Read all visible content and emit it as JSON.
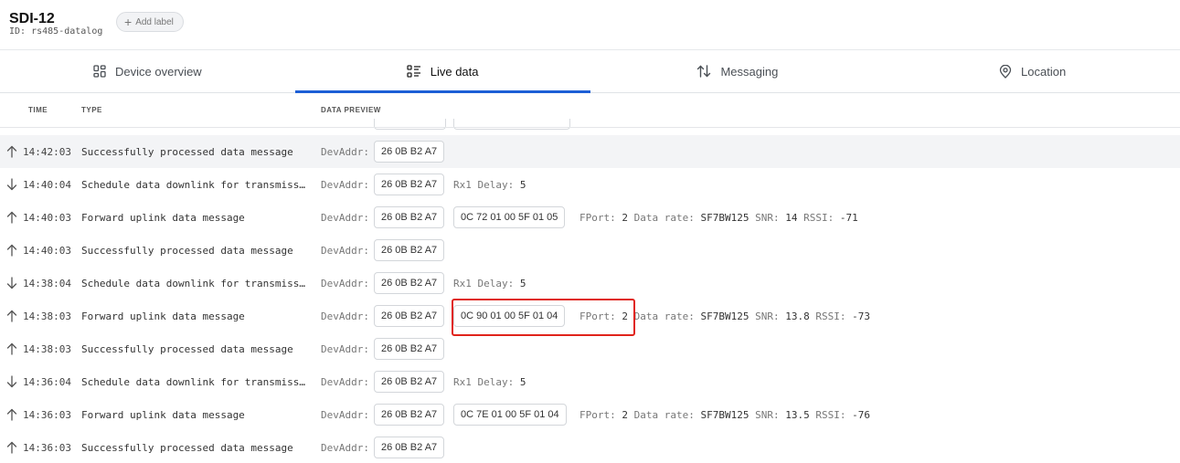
{
  "device": {
    "title": "SDI-12",
    "id_label": "ID:",
    "id_value": "rs485-datalog",
    "add_label": "Add label"
  },
  "tabs": [
    {
      "label": "Device overview",
      "icon": "grid-icon",
      "active": false
    },
    {
      "label": "Live data",
      "icon": "list-icon",
      "active": true
    },
    {
      "label": "Messaging",
      "icon": "arrows-updown-icon",
      "active": false
    },
    {
      "label": "Location",
      "icon": "pin-icon",
      "active": false
    }
  ],
  "columns": {
    "time": "TIME",
    "type": "TYPE",
    "preview": "DATA PREVIEW"
  },
  "rows": [
    {
      "dir": "up",
      "time": "14:42:03",
      "type": "Successfully processed data message",
      "label": "DevAddr:",
      "addr": "26 0B B2 A7",
      "payload": "",
      "extras": []
    },
    {
      "dir": "down",
      "time": "14:40:04",
      "type": "Schedule data downlink for transmission",
      "label": "DevAddr:",
      "addr": "26 0B B2 A7",
      "payload": "",
      "rx1_label": "Rx1 Delay:",
      "rx1_value": "5"
    },
    {
      "dir": "up",
      "time": "14:40:03",
      "type": "Forward uplink data message",
      "label": "DevAddr:",
      "addr": "26 0B B2 A7",
      "payload": "0C 72 01 00 5F 01 05",
      "fport_label": "FPort:",
      "fport": "2",
      "rate_label": "Data rate:",
      "rate": "SF7BW125",
      "snr_label": "SNR:",
      "snr": "14",
      "rssi_label": "RSSI:",
      "rssi": "-71"
    },
    {
      "dir": "up",
      "time": "14:40:03",
      "type": "Successfully processed data message",
      "label": "DevAddr:",
      "addr": "26 0B B2 A7",
      "payload": ""
    },
    {
      "dir": "down",
      "time": "14:38:04",
      "type": "Schedule data downlink for transmission",
      "label": "DevAddr:",
      "addr": "26 0B B2 A7",
      "payload": "",
      "rx1_label": "Rx1 Delay:",
      "rx1_value": "5"
    },
    {
      "dir": "up",
      "time": "14:38:03",
      "type": "Forward uplink data message",
      "label": "DevAddr:",
      "addr": "26 0B B2 A7",
      "payload": "0C 90 01 00 5F 01 04",
      "fport_label": "FPort:",
      "fport": "2",
      "rate_label": "Data rate:",
      "rate": "SF7BW125",
      "snr_label": "SNR:",
      "snr": "13.8",
      "rssi_label": "RSSI:",
      "rssi": "-73"
    },
    {
      "dir": "up",
      "time": "14:38:03",
      "type": "Successfully processed data message",
      "label": "DevAddr:",
      "addr": "26 0B B2 A7",
      "payload": ""
    },
    {
      "dir": "down",
      "time": "14:36:04",
      "type": "Schedule data downlink for transmission",
      "label": "DevAddr:",
      "addr": "26 0B B2 A7",
      "payload": "",
      "rx1_label": "Rx1 Delay:",
      "rx1_value": "5"
    },
    {
      "dir": "up",
      "time": "14:36:03",
      "type": "Forward uplink data message",
      "label": "DevAddr:",
      "addr": "26 0B B2 A7",
      "payload": "0C 7E 01 00 5F 01 04",
      "fport_label": "FPort:",
      "fport": "2",
      "rate_label": "Data rate:",
      "rate": "SF7BW125",
      "snr_label": "SNR:",
      "snr": "13.5",
      "rssi_label": "RSSI:",
      "rssi": "-76"
    },
    {
      "dir": "up",
      "time": "14:36:03",
      "type": "Successfully processed data message",
      "label": "DevAddr:",
      "addr": "26 0B B2 A7",
      "payload": ""
    }
  ],
  "colors": {
    "accent": "#1d5fd6",
    "annotation": "#e0231b"
  }
}
